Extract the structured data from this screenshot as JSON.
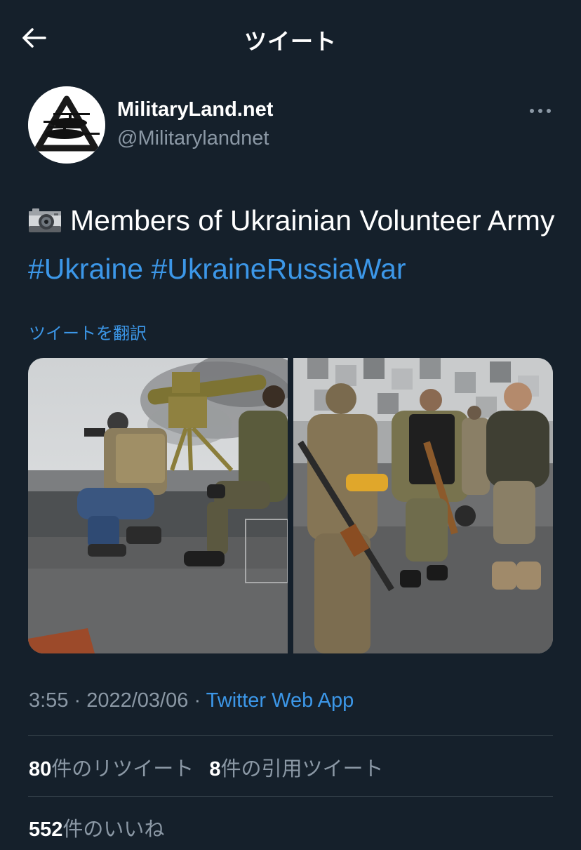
{
  "header": {
    "title": "ツイート",
    "back_icon": "arrow-left-icon"
  },
  "author": {
    "display_name": "MilitaryLand.net",
    "handle": "@Militarylandnet",
    "avatar_icon": "militaryland-logo"
  },
  "tweet": {
    "emoji_icon": "camera-icon",
    "text": "Members of Ukrainian Volunteer Army",
    "hashtags": [
      "#Ukraine",
      "#UkraineRussiaWar"
    ],
    "translate_label": "ツイートを翻訳"
  },
  "meta": {
    "time": "3:55",
    "separator": " · ",
    "date": "2022/03/06",
    "source": "Twitter Web App"
  },
  "stats": {
    "retweets_count": "80",
    "retweets_label": "件のリツイート",
    "quotes_count": "8",
    "quotes_label": "件の引用ツイート",
    "likes_count": "552",
    "likes_label": "件のいいね"
  },
  "colors": {
    "background": "#15202b",
    "link": "#3c97e8",
    "secondary_text": "#8b98a5",
    "divider": "#38444d"
  }
}
